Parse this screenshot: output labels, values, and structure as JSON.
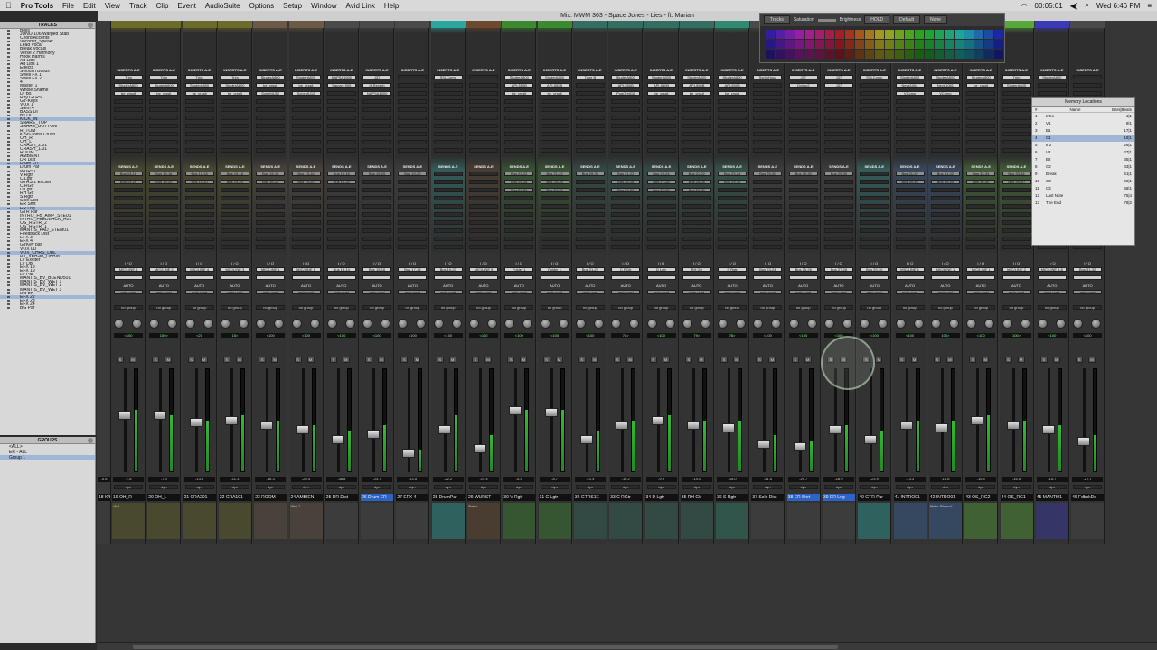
{
  "menubar": {
    "apple": "",
    "items": [
      "Pro Tools",
      "File",
      "Edit",
      "View",
      "Track",
      "Clip",
      "Event",
      "AudioSuite",
      "Options",
      "Setup",
      "Window",
      "Avid Link",
      "Help"
    ],
    "clock_counter": "00:05:01",
    "datetime": "Wed 6:46 PM"
  },
  "window": {
    "title": "Mix: MWM 363 - Space Jones - Lies - ft. Marian"
  },
  "tracks_panel": {
    "title": "TRACKS",
    "items": [
      "Bells",
      "JUNO-106 Warped Stab",
      "Chord Accents",
      "Vocoder_Speakr",
      "Lead Vocal",
      "Break Vocals",
      "Verse 2 Harmony",
      "Hook Harms",
      "Ad Libs",
      "Ad Libs 1",
      "Effects",
      "Swoosh Builds",
      "Swell FX 1",
      "Swell FX 2",
      "4",
      "Master 1",
      "Whole Shame",
      "Dr Bs",
      "Rhy GTRS",
      "Gtr-Keys",
      "VOX 1",
      "Stem 4",
      "BASS DI",
      "Bs DI",
      "KICK_IN",
      "SNARE_TOP",
      "SNARE_BOTTOM",
      "R_TOM",
      "K.Sn-Toms Crush",
      "OH_R",
      "OH_L",
      "CRASH_2.01",
      "CRASH_1.01",
      "ROOM",
      "AMBIENT",
      "DR Dist",
      "Drum ER",
      "Drum Par",
      "WURST",
      "V Rgtr",
      "C Lgtr",
      "GTRS 1 Exciter",
      "C RGtr",
      "D Lgtr",
      "RH Gtr",
      "S Rgtr",
      "Solo Dist",
      "ER Shrt",
      "ER Lng",
      "GTR Par",
      "INTRO_FB_AMP_STE01",
      "INTRO_FEEDBACK_R01",
      "OS_RGTR_2",
      "OS_RGTR_1",
      "MANTIS_PAD_STEM01",
      "Feedback Dist",
      "EFX 3",
      "EFX 4",
      "GtrKey par",
      "VOX LD",
      "VOX_CHRS_DBL",
      "BV_VERSE_HARM",
      "LV Exciter",
      "LV Dbl",
      "EFX 18",
      "EFX 19",
      "LV Par",
      "MANTIS_BV_BLEND501",
      "MANTIS_BV_WET 1",
      "MANTIS_BV_WET 2",
      "MANTIS_BV_WET 3",
      "BG ER",
      "EFX 22",
      "EFX 23",
      "EFX 24",
      "BG Par"
    ],
    "selected": [
      24,
      36,
      48,
      60,
      72
    ]
  },
  "groups_panel": {
    "title": "GROUPS",
    "items": [
      "<ALL>",
      "ER - ALL",
      "Group 1"
    ]
  },
  "palette": {
    "tracks_label": "Tracks",
    "saturation_label": "Saturation",
    "brightness_label": "Brightness",
    "hold_label": "HOLD",
    "default_label": "Default",
    "none_label": "None"
  },
  "memory_locations": {
    "title": "Memory Locations",
    "col_num": "#",
    "col_name": "Name",
    "col_bars": "Bars|Beats",
    "rows": [
      {
        "num": "1",
        "name": "Intro",
        "bars": "1|1"
      },
      {
        "num": "2",
        "name": "V1",
        "bars": "9|1"
      },
      {
        "num": "3",
        "name": "B1",
        "bars": "17|1"
      },
      {
        "num": "4",
        "name": "C1",
        "bars": "18|1"
      },
      {
        "num": "5",
        "name": "In2",
        "bars": "26|1"
      },
      {
        "num": "6",
        "name": "V2",
        "bars": "27|1"
      },
      {
        "num": "7",
        "name": "B2",
        "bars": "35|1"
      },
      {
        "num": "8",
        "name": "C2",
        "bars": "43|1"
      },
      {
        "num": "9",
        "name": "Break",
        "bars": "51|1"
      },
      {
        "num": "10",
        "name": "C3",
        "bars": "60|1"
      },
      {
        "num": "11",
        "name": "C4",
        "bars": "68|1"
      },
      {
        "num": "12",
        "name": "Last Note",
        "bars": "75|4"
      },
      {
        "num": "13",
        "name": "The End",
        "bars": "78|2"
      }
    ],
    "selected_index": 3
  },
  "strip_labels": {
    "inserts": "INSERTS A-E",
    "sends": "SENDS A-E",
    "io": "I / O",
    "auto": "AUTO",
    "auto_read": "auto read",
    "group": "no group",
    "mute": "M",
    "solo": "S",
    "dyn": "dyn"
  },
  "channels": [
    {
      "name": "19 OH_R",
      "color": "#6b6b2a",
      "input": "MIC/LINE 1",
      "pan": "<100",
      "vol": "-7.8",
      "ins": [
        "Trim",
        "StuderA800",
        "be_crsslt"
      ],
      "sends": [
        "Bus 13-16",
        "Bus 19-20"
      ],
      "fader": 0.55,
      "meter": 0.6,
      "comment": "-6.8"
    },
    {
      "name": "20 OH_L",
      "color": "#6b6b2a",
      "input": "MIC/LINE 2",
      "pan": "100>",
      "vol": "-7.3",
      "ins": [
        "Trim",
        "StuderA800",
        "be_crsslt"
      ],
      "sends": [
        "Bus 13-16",
        "Bus 19-20"
      ],
      "fader": 0.55,
      "meter": 0.55,
      "comment": ""
    },
    {
      "name": "21 CRA201",
      "color": "#6b6b2a",
      "input": "MIC/LINE 4",
      "pan": "<21",
      "vol": "-13.8",
      "ins": [
        "Trim",
        "StuderA800",
        "be_crsslt"
      ],
      "sends": [
        "Bus 15-16",
        "Bus 19-20"
      ],
      "fader": 0.48,
      "meter": 0.5,
      "comment": ""
    },
    {
      "name": "22 CRA101",
      "color": "#6b6b2a",
      "input": "MIC/LINE 3",
      "pan": "15>",
      "vol": "-11.3",
      "ins": [
        "Trim",
        "StuderA800",
        "be_crsslt"
      ],
      "sends": [
        "Bus 15-16",
        "Bus 19-20"
      ],
      "fader": 0.5,
      "meter": 0.55,
      "comment": ""
    },
    {
      "name": "23 ROOM",
      "color": "#6b5a45",
      "input": "MIC/LINE 1",
      "pan": "<100",
      "vol": "-16.3",
      "ins": [
        "StuderA800",
        "be_crsslt",
        "ScheMU12"
      ],
      "sends": [
        "Bus 13-16",
        "Bus 19-20"
      ],
      "fader": 0.45,
      "meter": 0.5,
      "comment": ""
    },
    {
      "name": "24 AMBIEN",
      "color": "#6b5a45",
      "input": "MIC/LINE 1",
      "pan": "<100",
      "vol": "-26.4",
      "ins": [
        "StuderA800",
        "be_crsslt",
        "ScheMU12"
      ],
      "sends": [
        "Bus 13-16",
        "Bus 19-20"
      ],
      "fader": 0.4,
      "meter": 0.45,
      "comment": "Kick ?"
    },
    {
      "name": "25 DR Dist",
      "color": "#4a4a4a",
      "input": "Bus 13-14",
      "pan": "<100",
      "vol": "-36.8",
      "ins": [
        "NAPSA1500",
        "Sauvex 905"
      ],
      "sends": [
        "Bus 15-16",
        "Bus 19-20"
      ],
      "fader": 0.3,
      "meter": 0.4,
      "comment": ""
    },
    {
      "name": "26 Drum ER",
      "color": "#4a4a4a",
      "input": "Bus 15-16",
      "pan": "<100",
      "vol": "-24.7",
      "ins": [
        "J37",
        "H-Reverb",
        "NAPSA1500"
      ],
      "sends": [
        "Bus 19-20"
      ],
      "fader": 0.35,
      "meter": 0.45,
      "comment": "",
      "selected": true
    },
    {
      "name": "27 EFX 4",
      "color": "#4a4a4a",
      "input": "Bus 17-18",
      "pan": "<100",
      "vol": "-13.5",
      "ins": [],
      "sends": [
        "Bus 19-20"
      ],
      "fader": 0.15,
      "meter": 0.2,
      "comment": ""
    },
    {
      "name": "28 DrumPar",
      "color": "#2aa8a0",
      "input": "Bus 19-20",
      "pan": "<100",
      "vol": "-22.2",
      "ins": [
        "SSLComp"
      ],
      "sends": [],
      "fader": 0.4,
      "meter": 0.55,
      "comment": ""
    },
    {
      "name": "29 WURST",
      "color": "#6b4a30",
      "input": "MIC/LINE 5",
      "pan": "<100",
      "vol": "-19.4",
      "ins": [],
      "sends": [],
      "fader": 0.2,
      "meter": 0.35,
      "comment": "Snare"
    },
    {
      "name": "30 V Rgtr",
      "color": "#3c8a30",
      "input": "Folder 1",
      "pan": "<100",
      "vol": "-5.5",
      "ins": [
        "StuderA800",
        "API-550B",
        "be_crsslt"
      ],
      "sends": [
        "Bus 21-22",
        "Bus 25-26",
        "Bus 29-30"
      ],
      "fader": 0.6,
      "meter": 0.6,
      "comment": ""
    },
    {
      "name": "31 C Lgtr",
      "color": "#3c8a30",
      "input": "Folder 1",
      "pan": "<100",
      "vol": "-8.7",
      "ins": [
        "StuderA800",
        "API-550B",
        "be_crsslt"
      ],
      "sends": [
        "Bus 21-22",
        "Bus 25-26",
        "Bus 29-30"
      ],
      "fader": 0.58,
      "meter": 0.6,
      "comment": ""
    },
    {
      "name": "32 GTRS1E",
      "color": "#356e60",
      "input": "Bus 21-22",
      "pan": "<100",
      "vol": "-21.4",
      "ins": [
        "Type B"
      ],
      "sends": [
        "Bus 29-30"
      ],
      "fader": 0.3,
      "meter": 0.4,
      "comment": ""
    },
    {
      "name": "33 C RGtr",
      "color": "#356e60",
      "input": "C RGtr",
      "pan": "78>",
      "vol": "-10.2",
      "ins": [
        "StuderA800",
        "API-550B",
        "PugOrbit16"
      ],
      "sends": [
        "Bus 21-22",
        "Bus 25-26",
        "Bus 29-30"
      ],
      "fader": 0.45,
      "meter": 0.5,
      "comment": ""
    },
    {
      "name": "34 D Lgtr",
      "color": "#356e60",
      "input": "D Lgtr",
      "pan": "<100",
      "vol": "-9.9",
      "ins": [
        "StuderA800",
        "API-550B",
        "be_crsslt"
      ],
      "sends": [
        "Bus 23-24",
        "Bus 27-28",
        "Bus 29-30"
      ],
      "fader": 0.5,
      "meter": 0.55,
      "comment": ""
    },
    {
      "name": "35 RH Gtr",
      "color": "#356e60",
      "input": "RH Gtr",
      "pan": "79>",
      "vol": "-14.0",
      "ins": [
        "StuderA800",
        "API-550B",
        "be_crsslt"
      ],
      "sends": [
        "Bus 21-22",
        "Bus 25-26",
        "Bus 29-30"
      ],
      "fader": 0.45,
      "meter": 0.5,
      "comment": ""
    },
    {
      "name": "36 S Rgtr",
      "color": "#2f8a70",
      "input": "S Rgtr",
      "pan": "78>",
      "vol": "-16.0",
      "ins": [
        "StuderA800",
        "API-550B",
        "be_crsslt"
      ],
      "sends": [
        "Bus 23-24",
        "Bus 29-30"
      ],
      "fader": 0.42,
      "meter": 0.5,
      "comment": ""
    },
    {
      "name": "37 Solo Dist",
      "color": "#4a4a4a",
      "input": "Bus 23-24",
      "pan": "<100",
      "vol": "-31.0",
      "ins": [
        "SynthHouz"
      ],
      "sends": [
        "Bus 29-30"
      ],
      "fader": 0.25,
      "meter": 0.35,
      "comment": ""
    },
    {
      "name": "38 ER Shrt",
      "color": "#4a4a4a",
      "input": "Bus 25-26",
      "pan": "<100",
      "vol": "-29.7",
      "ins": [
        "J37",
        "Oxlmp2"
      ],
      "sends": [
        "Bus 29-30"
      ],
      "fader": 0.22,
      "meter": 0.3,
      "comment": "",
      "selected": true
    },
    {
      "name": "39 ER Lng",
      "color": "#4a4a4a",
      "input": "Bus 27-28",
      "pan": "<100",
      "vol": "-16.9",
      "ins": [
        "J37",
        "J37"
      ],
      "sends": [
        "Bus 29-30"
      ],
      "fader": 0.4,
      "meter": 0.45,
      "comment": "",
      "selected": true
    },
    {
      "name": "40 GTR Par",
      "color": "#2aa8a0",
      "input": "Bus 29-30",
      "pan": "<100",
      "vol": "-23.9",
      "ins": [
        "SSLComp"
      ],
      "sends": [],
      "fader": 0.3,
      "meter": 0.4,
      "comment": ""
    },
    {
      "name": "41 INTRO01",
      "color": "#3d6aa6",
      "input": "MIC/LINE 1",
      "pan": "<100",
      "vol": "-13.3",
      "ins": [
        "StuderA800",
        "Neve1081",
        "VComp"
      ],
      "sends": [
        "Bus 31-32",
        "Bus 39-40"
      ],
      "fader": 0.45,
      "meter": 0.5,
      "comment": ""
    },
    {
      "name": "42 INTRO01",
      "color": "#3d6aa6",
      "input": "MIC/LINE 1",
      "pan": "100>",
      "vol": "-15.8",
      "ins": [
        "StuderA800",
        "Neve1081",
        "VComp"
      ],
      "sends": [
        "Bus 31-32",
        "Bus 39-40"
      ],
      "fader": 0.42,
      "meter": 0.5,
      "comment": "Make Stereo?"
    },
    {
      "name": "43 OS_RG2",
      "color": "#56a838",
      "input": "MIC/LINE 1",
      "pan": "<100",
      "vol": "-10.5",
      "ins": [
        "StuderA800",
        "be_crsslt"
      ],
      "sends": [
        "Bus 33-34",
        "Bus 39-40"
      ],
      "fader": 0.5,
      "meter": 0.55,
      "comment": ""
    },
    {
      "name": "44 OS_RG1",
      "color": "#56a838",
      "input": "MIC/LINE 2",
      "pan": "100>",
      "vol": "-16.5",
      "ins": [
        "Trim",
        "StuderA800"
      ],
      "sends": [
        "Bus 33-34",
        "Bus 39-40"
      ],
      "fader": 0.45,
      "meter": 0.5,
      "comment": ""
    },
    {
      "name": "45 MANTI01",
      "color": "#3a3ab8",
      "input": "MIC/LINE 5-6",
      "pan": "<100",
      "vol": "-15.7",
      "ins": [
        "StuderA800"
      ],
      "sends": [
        "Bus 39-40"
      ],
      "fader": 0.4,
      "meter": 0.45,
      "comment": ""
    },
    {
      "name": "46 FdbckDs",
      "color": "#4a4a4a",
      "input": "Bus 31-32",
      "pan": "<100",
      "vol": "-27.7",
      "ins": [],
      "sends": [],
      "fader": 0.28,
      "meter": 0.35,
      "comment": ""
    }
  ],
  "fx_strip_partial": {
    "name": "18 K/S",
    "vol": "-4.8"
  }
}
